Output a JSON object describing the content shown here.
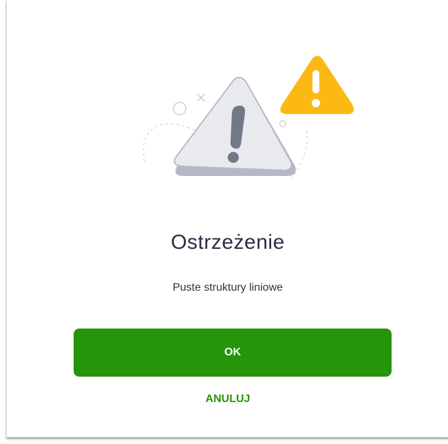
{
  "dialog": {
    "title": "Ostrzeżenie",
    "message": "Puste struktury liniowe",
    "ok_label": "OK",
    "cancel_label": "ANULUJ"
  },
  "icons": {
    "main": "warning-triangle-icon",
    "badge": "warning-badge-icon"
  },
  "colors": {
    "primary": "#279509",
    "warning_badge": "#FDB913",
    "title_text": "#2B2D44"
  }
}
